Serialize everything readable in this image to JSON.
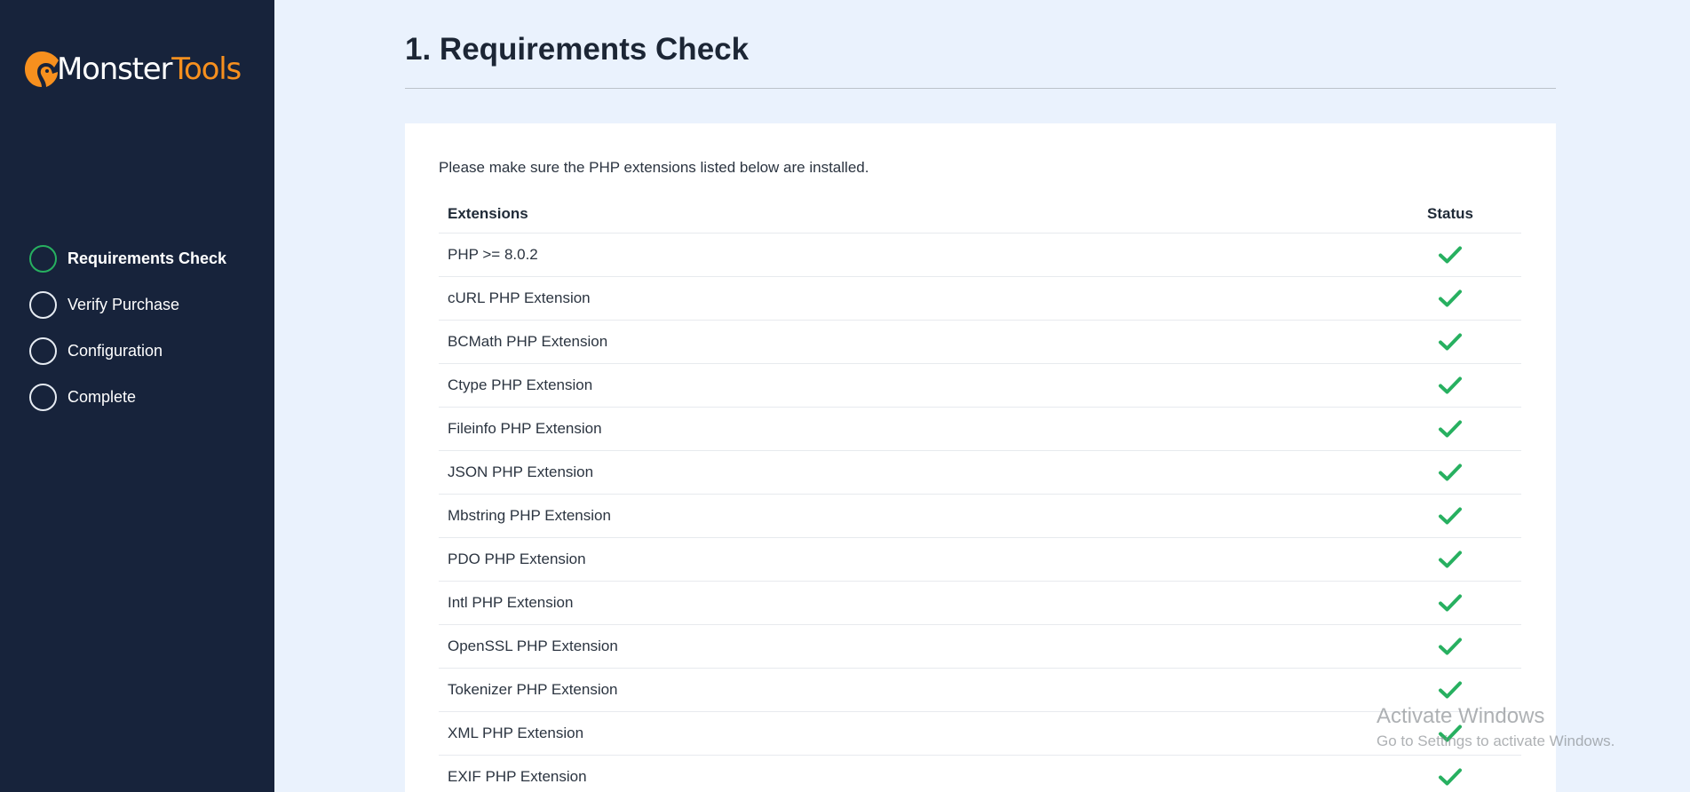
{
  "app": {
    "logo_part1": "Monster",
    "logo_part2": "Tools"
  },
  "sidebar": {
    "steps": [
      {
        "label": "Requirements Check",
        "active": true
      },
      {
        "label": "Verify Purchase",
        "active": false
      },
      {
        "label": "Configuration",
        "active": false
      },
      {
        "label": "Complete",
        "active": false
      }
    ]
  },
  "main": {
    "title": "1. Requirements Check",
    "intro": "Please make sure the PHP extensions listed below are installed.",
    "table": {
      "headers": [
        "Extensions",
        "Status"
      ],
      "rows": [
        {
          "name": "PHP >= 8.0.2",
          "status_icon": "check-icon"
        },
        {
          "name": "cURL PHP Extension",
          "status_icon": "check-icon"
        },
        {
          "name": "BCMath PHP Extension",
          "status_icon": "check-icon"
        },
        {
          "name": "Ctype PHP Extension",
          "status_icon": "check-icon"
        },
        {
          "name": "Fileinfo PHP Extension",
          "status_icon": "check-icon"
        },
        {
          "name": "JSON PHP Extension",
          "status_icon": "check-icon"
        },
        {
          "name": "Mbstring PHP Extension",
          "status_icon": "check-icon"
        },
        {
          "name": "PDO PHP Extension",
          "status_icon": "check-icon"
        },
        {
          "name": "Intl PHP Extension",
          "status_icon": "check-icon"
        },
        {
          "name": "OpenSSL PHP Extension",
          "status_icon": "check-icon"
        },
        {
          "name": "Tokenizer PHP Extension",
          "status_icon": "check-icon"
        },
        {
          "name": "XML PHP Extension",
          "status_icon": "check-icon"
        },
        {
          "name": "EXIF PHP Extension",
          "status_icon": "check-icon"
        }
      ]
    }
  },
  "watermark": {
    "line1": "Activate Windows",
    "line2": "Go to Settings to activate Windows."
  },
  "colors": {
    "sidebar_bg": "#17233b",
    "page_bg": "#eaf2fd",
    "brand_orange": "#f7901e",
    "success_green": "#27b060"
  }
}
